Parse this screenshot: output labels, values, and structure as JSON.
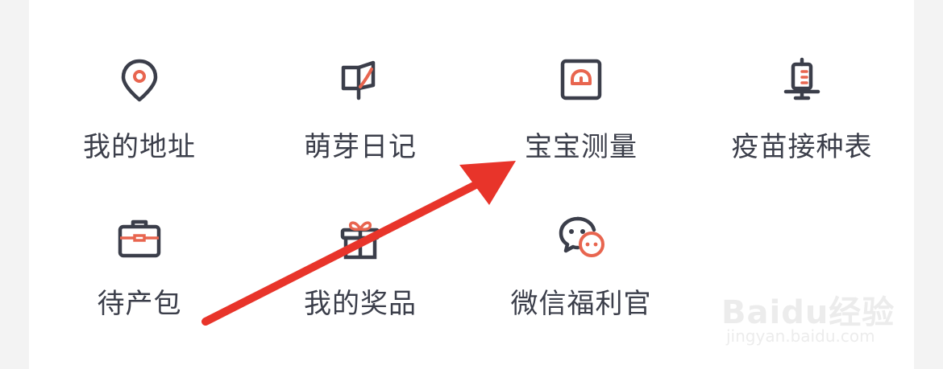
{
  "menu": {
    "row1": [
      {
        "label": "我的地址",
        "icon": "location-pin-icon"
      },
      {
        "label": "萌芽日记",
        "icon": "book-sprout-icon"
      },
      {
        "label": "宝宝测量",
        "icon": "scale-icon"
      },
      {
        "label": "疫苗接种表",
        "icon": "vaccine-chart-icon"
      }
    ],
    "row2": [
      {
        "label": "待产包",
        "icon": "suitcase-icon"
      },
      {
        "label": "我的奖品",
        "icon": "gift-icon"
      },
      {
        "label": "微信福利官",
        "icon": "chat-bubbles-icon"
      }
    ]
  },
  "colors": {
    "icon_stroke": "#3b3e4a",
    "accent": "#e8654f",
    "arrow": "#e8342a"
  },
  "watermark": {
    "brand": "Baidu经验",
    "url": "jingyan.baidu.com"
  }
}
